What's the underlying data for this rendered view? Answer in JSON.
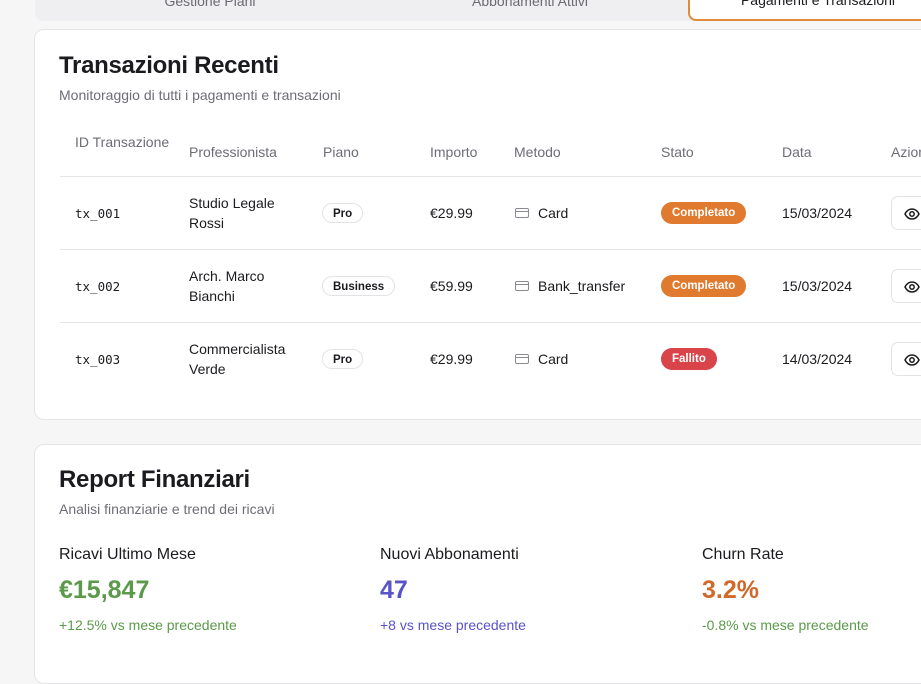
{
  "tabs": [
    {
      "label": "Gestione Piani"
    },
    {
      "label": "Abbonamenti Attivi"
    },
    {
      "label": "Pagamenti e Transazioni"
    }
  ],
  "transactions": {
    "title": "Transazioni Recenti",
    "subtitle": "Monitoraggio di tutti i pagamenti e transazioni",
    "columns": {
      "id": "ID Transazione",
      "professional": "Professionista",
      "plan": "Piano",
      "amount": "Importo",
      "method": "Metodo",
      "status": "Stato",
      "date": "Data",
      "actions": "Azioni"
    },
    "rows": [
      {
        "id": "tx_001",
        "professional": "Studio Legale Rossi",
        "plan": "Pro",
        "amount": "€29.99",
        "method": "Card",
        "status": "Completato",
        "date": "15/03/2024"
      },
      {
        "id": "tx_002",
        "professional": "Arch. Marco Bianchi",
        "plan": "Business",
        "amount": "€59.99",
        "method": "Bank_transfer",
        "status": "Completato",
        "date": "15/03/2024"
      },
      {
        "id": "tx_003",
        "professional": "Commercialista Verde",
        "plan": "Pro",
        "amount": "€29.99",
        "method": "Card",
        "status": "Fallito",
        "date": "14/03/2024"
      }
    ],
    "status_colors": {
      "Completato": "#e07a2e",
      "Fallito": "#d9434a"
    }
  },
  "finance": {
    "title": "Report Finanziari",
    "subtitle": "Analisi finanziarie e trend dei ricavi",
    "stats": [
      {
        "label": "Ricavi Ultimo Mese",
        "value": "€15,847",
        "trend": "+12.5% vs mese precedente",
        "color": "#5a9a4a"
      },
      {
        "label": "Nuovi Abbonamenti",
        "value": "47",
        "trend": "+8 vs mese precedente",
        "color": "#5a52c9"
      },
      {
        "label": "Churn Rate",
        "value": "3.2%",
        "trend": "-0.8% vs mese precedente",
        "color": "#d0692b"
      }
    ]
  }
}
